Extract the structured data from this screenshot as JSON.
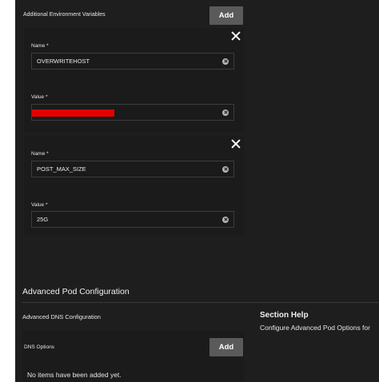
{
  "env_vars": {
    "title": "Additional Environment Variables",
    "add_label": "Add",
    "items": [
      {
        "name_label": "Name *",
        "name_value": "OVERWRITEHOST",
        "value_label": "Value *",
        "value_value": "",
        "value_redacted": true
      },
      {
        "name_label": "Name *",
        "name_value": "POST_MAX_SIZE",
        "value_label": "Value *",
        "value_value": "25G",
        "value_redacted": false
      }
    ]
  },
  "advanced": {
    "heading": "Advanced Pod Configuration",
    "dns_title": "Advanced DNS Configuration",
    "dns_options_label": "DNS Options",
    "add_label": "Add",
    "empty_text": "No items have been added yet."
  },
  "help": {
    "title": "Section Help",
    "text": "Configure Advanced Pod Options for"
  },
  "colors": {
    "panel_bg": "#1e1e1e",
    "button_bg": "#5a5a5a",
    "redaction": "#e40000"
  },
  "icons": {
    "remove": "close-icon",
    "clear": "clear-circle-icon"
  }
}
